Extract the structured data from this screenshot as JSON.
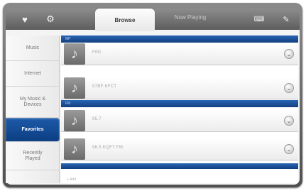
{
  "tabs": {
    "active": "Browse",
    "inactive": "Now Playing"
  },
  "topbar": {
    "left_icons": [
      "heart-icon",
      "gear-icon"
    ],
    "right_icons": [
      "keyboard-icon",
      "wrench-icon"
    ]
  },
  "sidebar": {
    "items": [
      {
        "label": "Music",
        "selected": false
      },
      {
        "label": "Internet",
        "selected": false
      },
      {
        "label": "My Music & Devices",
        "selected": false
      },
      {
        "label": "Favorites",
        "selected": true
      },
      {
        "label": "Recently Played",
        "selected": false
      }
    ]
  },
  "list": {
    "sections": [
      {
        "header": "MP",
        "rows": [
          {
            "label": "FM1"
          },
          {
            "label": "97BF KFCT"
          }
        ]
      },
      {
        "header": "FM",
        "rows": [
          {
            "label": "95.7"
          },
          {
            "label": "96.5 KQFT FM"
          }
        ]
      }
    ],
    "footer": "+ Add"
  },
  "colors": {
    "accent": "#1a4f98",
    "selected": "#123f80"
  }
}
